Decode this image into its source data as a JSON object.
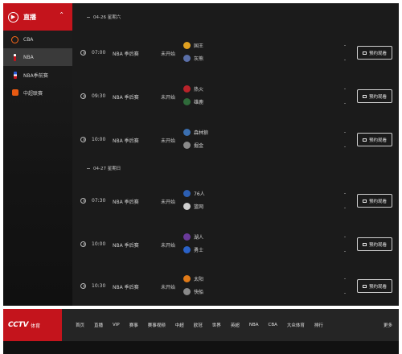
{
  "sidebar": {
    "title": "直播",
    "items": [
      {
        "label": "CBA",
        "icon": "cba-ball-icon",
        "active": false
      },
      {
        "label": "NBA",
        "icon": "nba-logo-icon",
        "active": true
      },
      {
        "label": "NBA季前赛",
        "icon": "nba-preseason-icon",
        "active": false
      },
      {
        "label": "中超联赛",
        "icon": "csl-cup-icon",
        "active": false
      }
    ]
  },
  "dates": [
    {
      "label": "04-26 星期六"
    },
    {
      "label": "04-27 星期日"
    }
  ],
  "matches": [
    {
      "time": "07:00",
      "league": "NBA 季后赛",
      "status": "未开始",
      "home": "国王",
      "away": "灰熊",
      "home_color": "#e0a020",
      "away_color": "#5a6fa8",
      "button": "预约观看"
    },
    {
      "time": "09:30",
      "league": "NBA 季后赛",
      "status": "未开始",
      "home": "热火",
      "away": "雄鹿",
      "home_color": "#b8232a",
      "away_color": "#2f6b3a",
      "button": "预约观看"
    },
    {
      "time": "10:00",
      "league": "NBA 季后赛",
      "status": "未开始",
      "home": "森林狼",
      "away": "掘金",
      "home_color": "#3b6fb0",
      "away_color": "#8a8a8a",
      "button": "预约观看"
    },
    {
      "time": "07:30",
      "league": "NBA 季后赛",
      "status": "未开始",
      "home": "76人",
      "away": "篮网",
      "home_color": "#2c5fb3",
      "away_color": "#cfcfcf",
      "button": "预约观看"
    },
    {
      "time": "10:00",
      "league": "NBA 季后赛",
      "status": "未开始",
      "home": "湖人",
      "away": "勇士",
      "home_color": "#6a3a9a",
      "away_color": "#2a62c9",
      "button": "预约观看"
    },
    {
      "time": "10:30",
      "league": "NBA 季后赛",
      "status": "未开始",
      "home": "太阳",
      "away": "快船",
      "home_color": "#e07a18",
      "away_color": "#8a8a8a",
      "button": "预约观看"
    }
  ],
  "navbar": {
    "brand": "CCTV",
    "brand_sub": "体育",
    "items": [
      "首页",
      "直播",
      "VIP",
      "赛事",
      "赛事视频",
      "中超",
      "欧冠",
      "世界",
      "英超",
      "NBA",
      "CBA",
      "大众体育",
      "排行"
    ],
    "more": "更多"
  }
}
